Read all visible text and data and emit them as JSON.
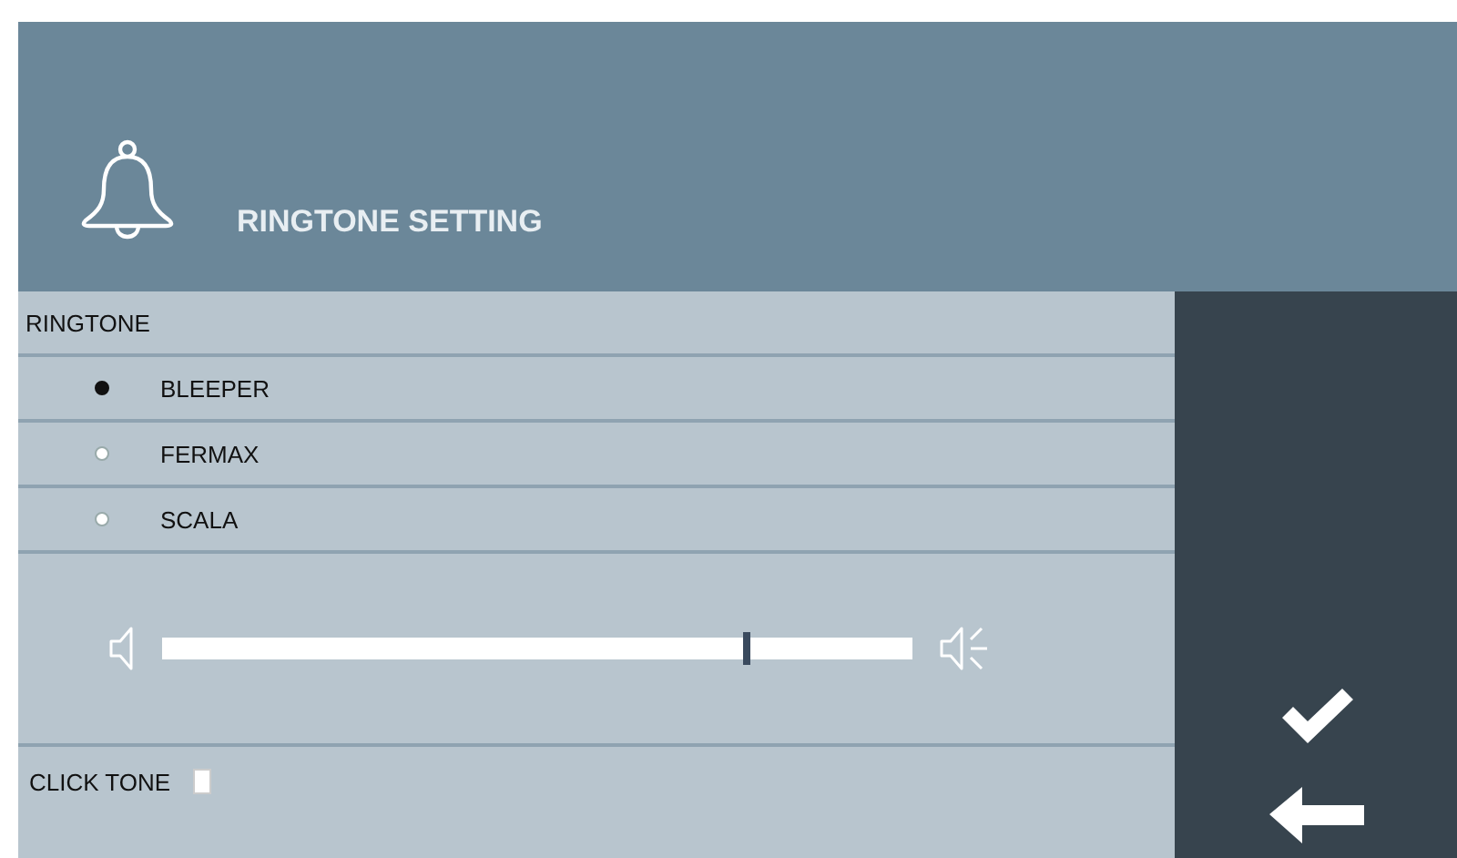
{
  "header": {
    "title": "RINGTONE SETTING"
  },
  "ringtone": {
    "label": "RINGTONE",
    "options": [
      {
        "label": "BLEEPER",
        "selected": true
      },
      {
        "label": "FERMAX",
        "selected": false
      },
      {
        "label": "SCALA",
        "selected": false
      }
    ]
  },
  "volume": {
    "level": 0.78
  },
  "click_tone": {
    "label": "CLICK TONE",
    "checked": false
  }
}
